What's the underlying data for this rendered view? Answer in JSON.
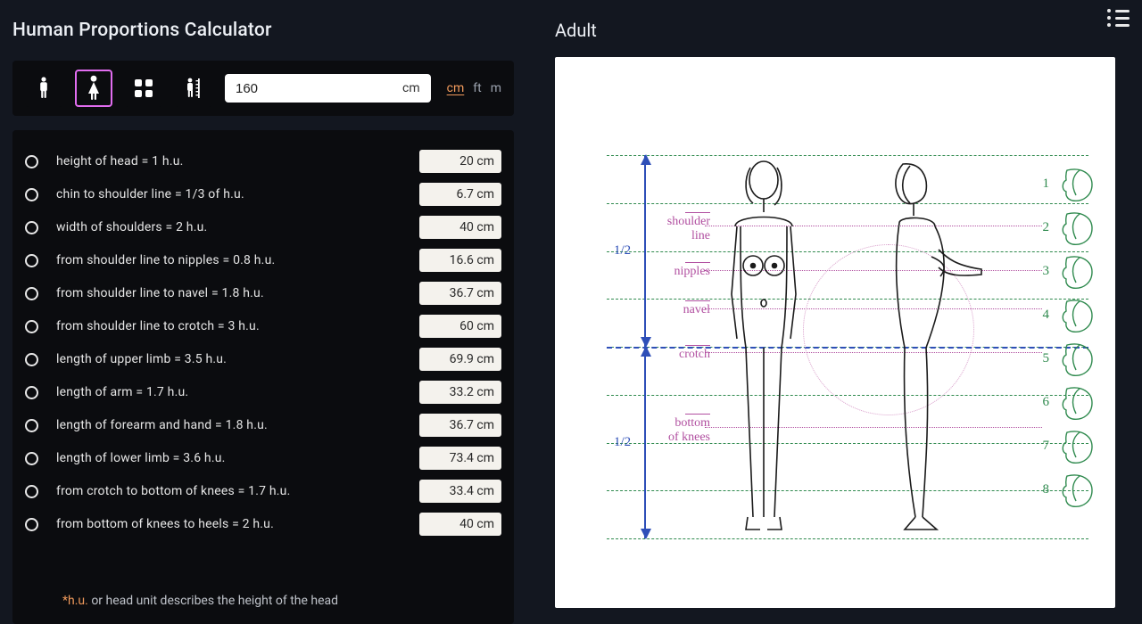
{
  "title": "Human Proportions Calculator",
  "figure_title": "Adult",
  "height": {
    "value": "160",
    "suffix": "cm"
  },
  "units": {
    "cm": "cm",
    "ft": "ft",
    "m": "m",
    "active": "cm"
  },
  "rows": [
    {
      "label": "height of head = 1 h.u.",
      "value": "20 cm"
    },
    {
      "label": "chin to shoulder line = 1/3 of h.u.",
      "value": "6.7 cm"
    },
    {
      "label": "width of shoulders = 2 h.u.",
      "value": "40 cm"
    },
    {
      "label": "from shoulder line to nipples = 0.8 h.u.",
      "value": "16.6 cm"
    },
    {
      "label": "from shoulder line to navel = 1.8 h.u.",
      "value": "36.7 cm"
    },
    {
      "label": "from shoulder line to crotch = 3 h.u.",
      "value": "60 cm"
    },
    {
      "label": "length of upper limb = 3.5 h.u.",
      "value": "69.9 cm"
    },
    {
      "label": "length of arm = 1.7 h.u.",
      "value": "33.2 cm"
    },
    {
      "label": "length of forearm and hand = 1.8 h.u.",
      "value": "36.7 cm"
    },
    {
      "label": "length of lower limb = 3.6 h.u.",
      "value": "73.4 cm"
    },
    {
      "label": "from crotch to bottom of knees = 1.7 h.u.",
      "value": "33.4 cm"
    },
    {
      "label": "from bottom of knees to heels = 2 h.u.",
      "value": "40 cm"
    }
  ],
  "footnote": {
    "star": "*h.u.",
    "rest": " or head unit describes the height of the head"
  },
  "diagram": {
    "half": "1/2",
    "annotations": {
      "shoulder": "shoulder\nline",
      "nipples": "nipples",
      "navel": "navel",
      "crotch": "crotch",
      "knees": "bottom\nof knees"
    },
    "head_numbers": [
      "1",
      "2",
      "3",
      "4",
      "5",
      "6",
      "7",
      "8"
    ]
  }
}
